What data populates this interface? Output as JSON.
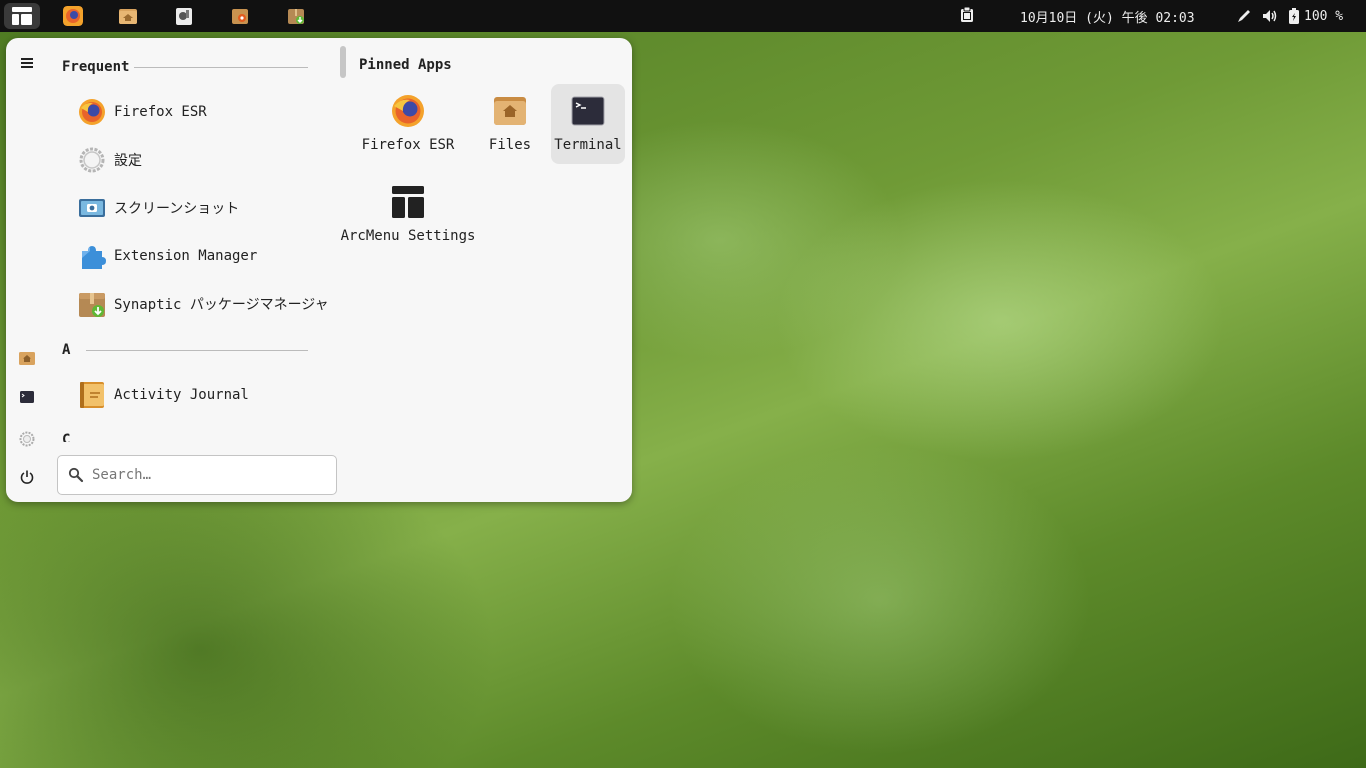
{
  "topbar": {
    "clock": "10月10日 (火) 午後 02:03",
    "battery": "100 %",
    "launchers": [
      "firefox-icon",
      "files-icon",
      "gimp-icon",
      "software-center-icon",
      "synaptic-icon"
    ]
  },
  "menu": {
    "frequent_header": "Frequent",
    "frequent_apps": [
      {
        "label": "Firefox ESR",
        "icon": "firefox-icon"
      },
      {
        "label": "設定",
        "icon": "settings-gear-icon"
      },
      {
        "label": "スクリーンショット",
        "icon": "screenshot-icon"
      },
      {
        "label": "Extension Manager",
        "icon": "puzzle-icon"
      },
      {
        "label": "Synaptic パッケージマネージャ",
        "icon": "synaptic-icon"
      }
    ],
    "section_a_header": "A",
    "section_a_apps": [
      {
        "label": "Activity Journal",
        "icon": "journal-icon"
      }
    ],
    "section_c_header": "C",
    "search": {
      "placeholder": "Search…",
      "value": ""
    },
    "pinned_header": "Pinned Apps",
    "pinned_apps": [
      {
        "label": "Firefox ESR",
        "icon": "firefox-icon"
      },
      {
        "label": "Files",
        "icon": "files-folder-icon"
      },
      {
        "label": "Terminal",
        "icon": "terminal-icon",
        "selected": true
      },
      {
        "label": "ArcMenu Settings",
        "icon": "arcmenu-icon"
      }
    ]
  },
  "colors": {
    "menu_bg": "#f7f7f7",
    "topbar_bg": "#111111",
    "selected_bg": "#e4e4e4",
    "firefox_orange": "#e8632b",
    "folder_tan": "#d9a35e"
  }
}
